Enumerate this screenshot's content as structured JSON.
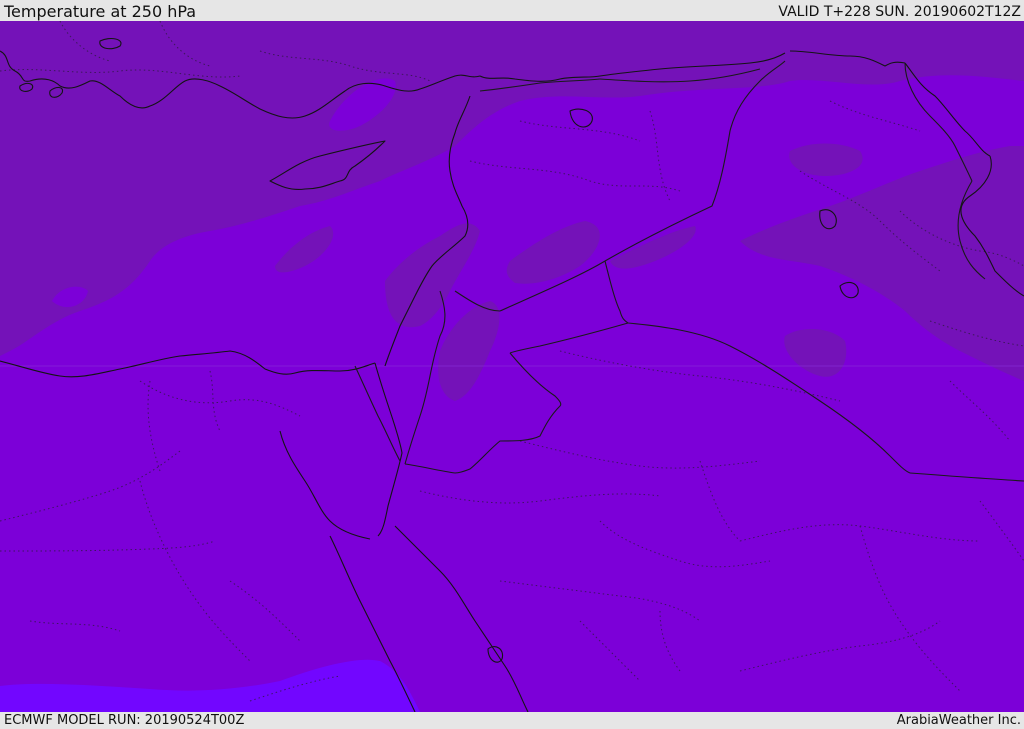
{
  "header": {
    "title": "Temperature at 250 hPa",
    "valid_time": "VALID T+228 SUN. 20190602T12Z"
  },
  "footer": {
    "model_run": "ECMWF MODEL RUN: 20190524T00Z",
    "credit": "ArabiaWeather Inc."
  },
  "map": {
    "field": "Temperature",
    "level": "250 hPa",
    "colors": {
      "base": "#7c00d8",
      "warm_band": "#7412b8",
      "cool_patch": "#7206ff",
      "coastline": "#141414",
      "border": "#1a1a1a"
    }
  }
}
